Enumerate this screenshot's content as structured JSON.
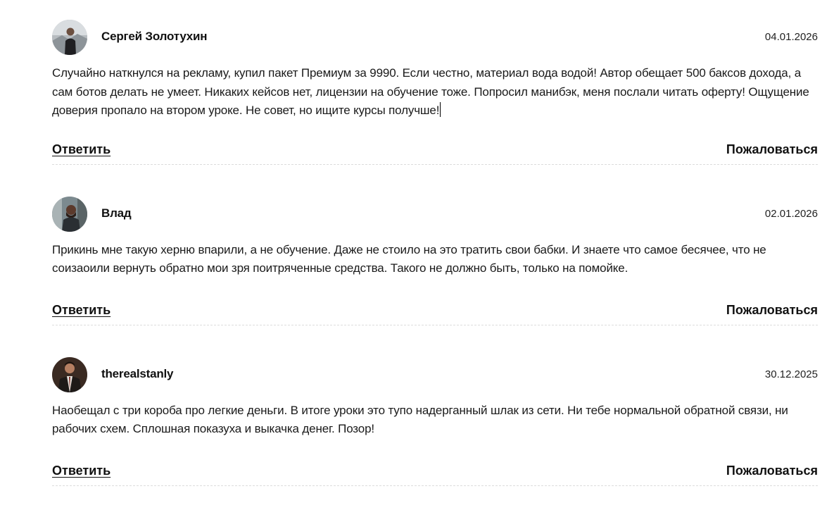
{
  "comments": [
    {
      "author": "Сергей Золотухин",
      "date": "04.01.2026",
      "text": "Случайно наткнулся на рекламу, купил пакет Премиум за 9990. Если честно, материал вода водой! Автор обещает 500 баксов дохода, а сам ботов делать не умеет. Никаких кейсов нет, лицензии на обучение тоже. Попросил манибэк, меня послали читать оферту! Ощущение доверия пропало на втором уроке. Не совет, но ищите курсы получше!",
      "reply_label": "Ответить",
      "report_label": "Пожаловаться"
    },
    {
      "author": "Влад",
      "date": "02.01.2026",
      "text": "Прикинь мне такую херню впарили, а не обучение. Даже не стоило на это тратить свои бабки. И знаете что самое бесячее, что не соизаоили вернуть обратно мои зря поитряченные средства. Такого не должно быть, только на помойке.",
      "reply_label": "Ответить",
      "report_label": "Пожаловаться"
    },
    {
      "author": "therealstanly",
      "date": "30.12.2025",
      "text": "Наобещал с три короба про легкие деньги. В итоге уроки это тупо надерганный шлак из сети. Ни тебе нормальной обратной связи, ни рабочих схем. Сплошная показуха и выкачка денег. Позор!",
      "reply_label": "Ответить",
      "report_label": "Пожаловаться"
    }
  ]
}
